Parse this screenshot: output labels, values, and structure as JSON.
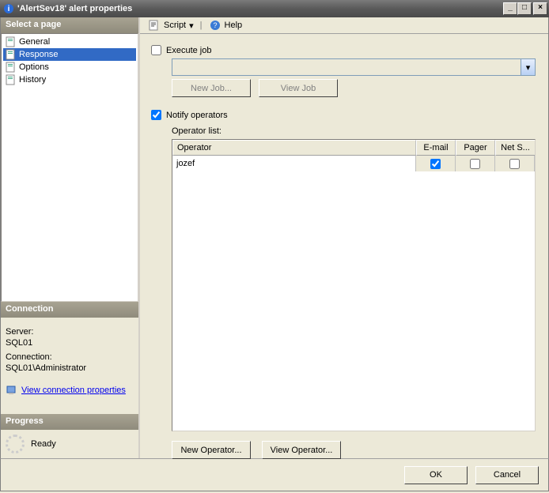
{
  "window_title": "'AlertSev18' alert properties",
  "sidebar": {
    "select_page_header": "Select a page",
    "pages": [
      {
        "label": "General"
      },
      {
        "label": "Response",
        "selected": true
      },
      {
        "label": "Options"
      },
      {
        "label": "History"
      }
    ],
    "connection_header": "Connection",
    "server_label": "Server:",
    "server_value": "SQL01",
    "connection_label": "Connection:",
    "connection_value": "SQL01\\Administrator",
    "view_conn_link": "View connection properties",
    "progress_header": "Progress",
    "progress_status": "Ready"
  },
  "toolbar": {
    "script_label": "Script",
    "help_label": "Help"
  },
  "main": {
    "execute_job_label": "Execute job",
    "execute_job_checked": false,
    "new_job_btn": "New Job...",
    "view_job_btn": "View Job",
    "notify_label": "Notify operators",
    "notify_checked": true,
    "operator_list_label": "Operator list:",
    "columns": {
      "operator": "Operator",
      "email": "E-mail",
      "pager": "Pager",
      "net": "Net S..."
    },
    "rows": [
      {
        "operator": "jozef",
        "email": true,
        "pager": false,
        "net": false
      }
    ],
    "new_operator_btn": "New Operator...",
    "view_operator_btn": "View Operator..."
  },
  "footer": {
    "ok": "OK",
    "cancel": "Cancel"
  }
}
